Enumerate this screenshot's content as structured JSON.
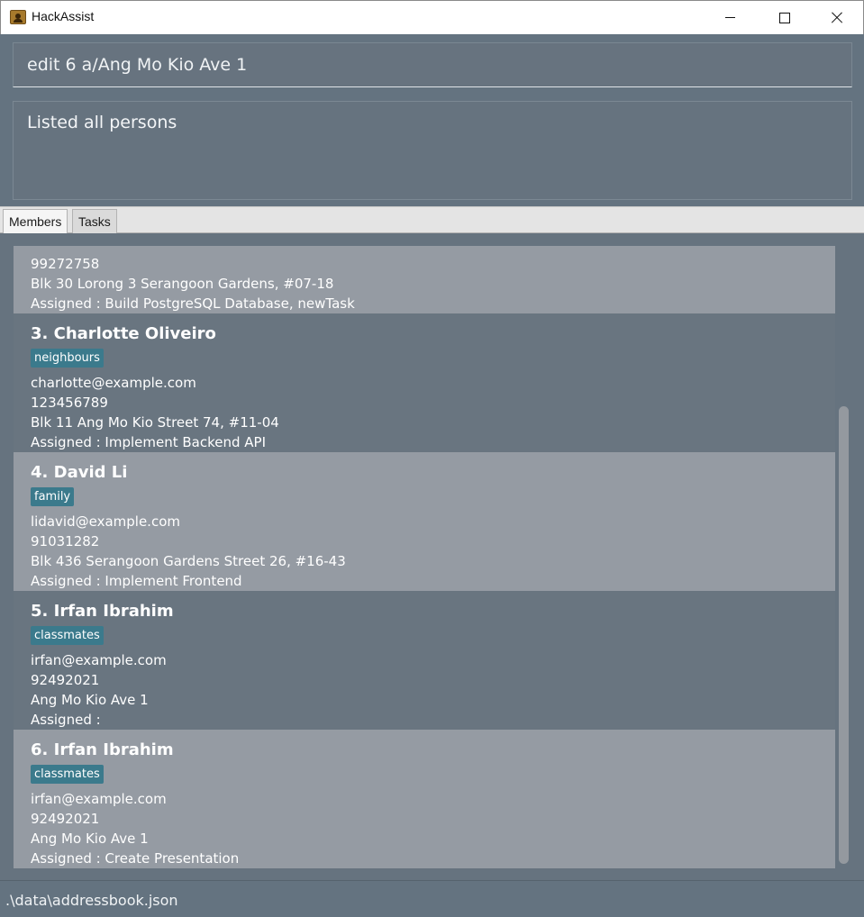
{
  "window": {
    "title": "HackAssist",
    "icon": "app-contacts-icon"
  },
  "command": {
    "value": "edit 6 a/Ang Mo Kio Ave 1"
  },
  "result": {
    "text": "Listed all persons"
  },
  "tabs": [
    {
      "label": "Members",
      "selected": true
    },
    {
      "label": "Tasks",
      "selected": false
    }
  ],
  "members": [
    {
      "name": "",
      "tag": "",
      "email": "",
      "phone": "99272758",
      "address": "Blk 30 Lorong 3 Serangoon Gardens, #07-18",
      "assigned": "Assigned :  Build PostgreSQL Database, newTask"
    },
    {
      "name": "3.  Charlotte Oliveiro",
      "tag": "neighbours",
      "email": "charlotte@example.com",
      "phone": "123456789",
      "address": "Blk 11 Ang Mo Kio Street 74, #11-04",
      "assigned": "Assigned :  Implement Backend API"
    },
    {
      "name": "4.  David Li",
      "tag": "family",
      "email": "lidavid@example.com",
      "phone": "91031282",
      "address": "Blk 436 Serangoon Gardens Street 26, #16-43",
      "assigned": "Assigned :  Implement Frontend"
    },
    {
      "name": "5.  Irfan Ibrahim",
      "tag": "classmates",
      "email": "irfan@example.com",
      "phone": "92492021",
      "address": "Ang Mo Kio Ave 1",
      "assigned": "Assigned :"
    },
    {
      "name": "6.  Irfan Ibrahim",
      "tag": "classmates",
      "email": "irfan@example.com",
      "phone": "92492021",
      "address": "Ang Mo Kio Ave 1",
      "assigned": "Assigned :  Create Presentation"
    }
  ],
  "status": {
    "path": ".\\data\\addressbook.json"
  },
  "colors": {
    "tag": "#3b7a8c",
    "card_light": "#959ba3",
    "card_dark": "#697580",
    "background": "#647380"
  }
}
